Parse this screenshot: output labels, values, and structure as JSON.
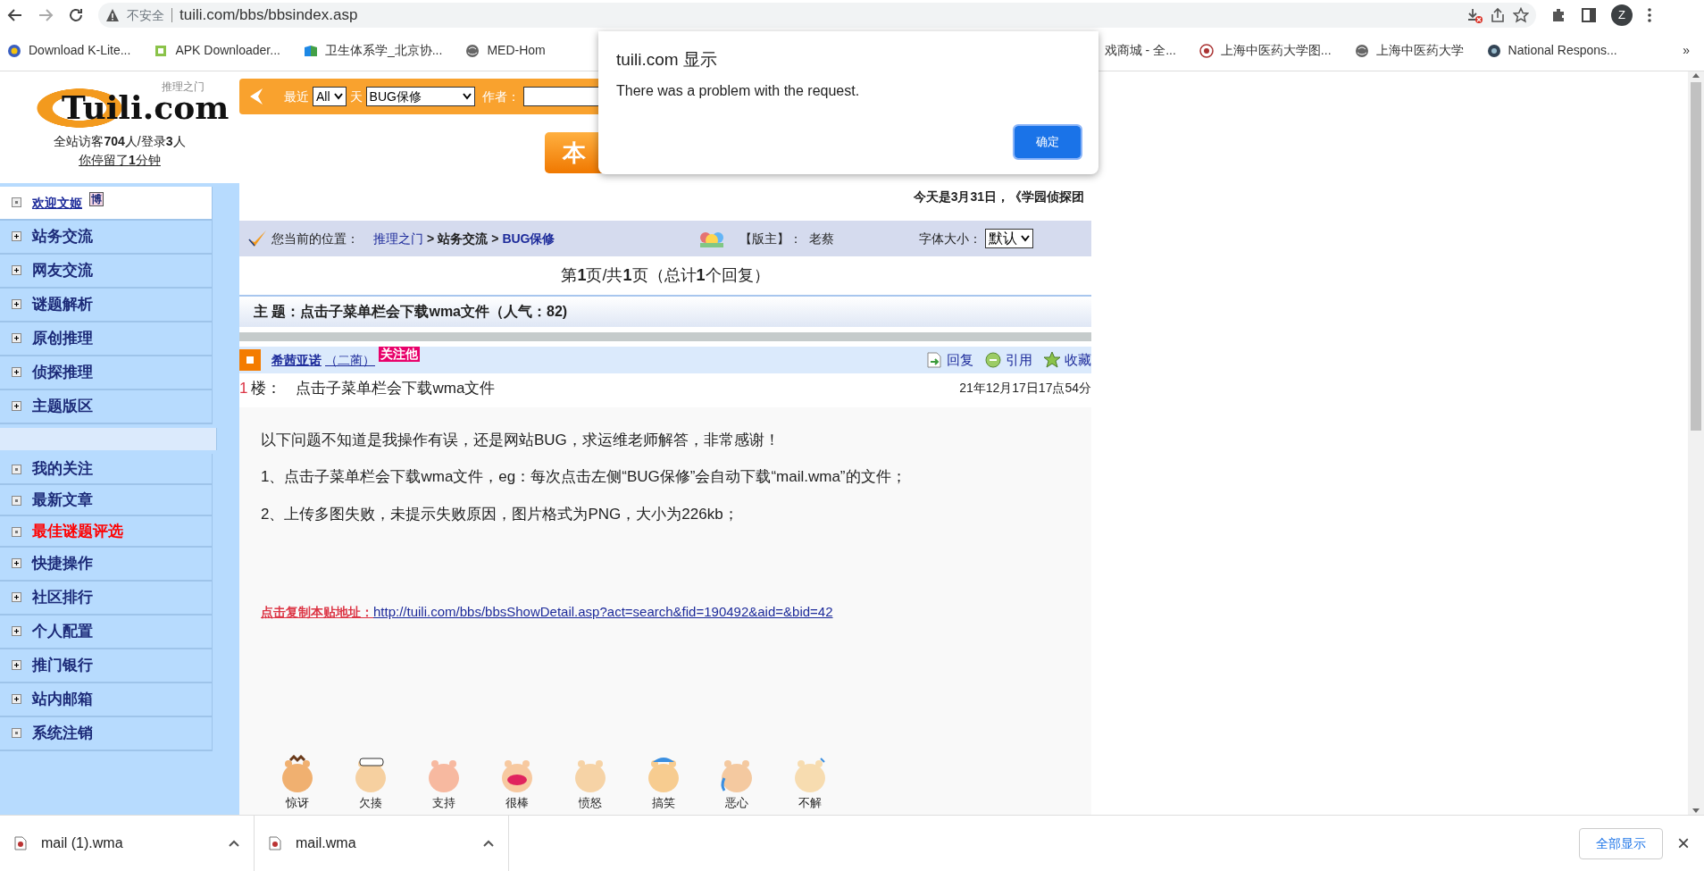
{
  "browser": {
    "security": "不安全",
    "url": "tuili.com/bbs/bbsindex.asp",
    "profile": "Z"
  },
  "bookmarks": [
    {
      "label": "Download K-Lite..."
    },
    {
      "label": "APK Downloader..."
    },
    {
      "label": "卫生体系学_北京协..."
    },
    {
      "label": "MED-Hom"
    },
    {
      "label": "戏商城 - 全..."
    },
    {
      "label": "上海中医药大学图..."
    },
    {
      "label": "上海中医药大学"
    },
    {
      "label": "National Respons..."
    }
  ],
  "bookmarks_more": "»",
  "dialog": {
    "title": "tuili.com 显示",
    "message": "There was a problem with the request.",
    "button": "确定"
  },
  "site": {
    "logo": "Tuili.com",
    "logo_sub": "推理之门",
    "visitors": "全站访客**704**人/登录**3**人",
    "stay": "你停留了**1**分钟"
  },
  "sidebar": {
    "items": [
      {
        "kind": "user",
        "label": "欢迎文姬",
        "badge": "博",
        "expandable": false,
        "highlight": false
      },
      {
        "kind": "item",
        "label": "站务交流",
        "expandable": true,
        "highlight": false
      },
      {
        "kind": "item",
        "label": "网友交流",
        "expandable": true,
        "highlight": false
      },
      {
        "kind": "item",
        "label": "谜题解析",
        "expandable": true,
        "highlight": false
      },
      {
        "kind": "item",
        "label": "原创推理",
        "expandable": true,
        "highlight": false
      },
      {
        "kind": "item",
        "label": "侦探推理",
        "expandable": true,
        "highlight": false
      },
      {
        "kind": "item",
        "label": "主题版区",
        "expandable": true,
        "highlight": false
      },
      {
        "kind": "spacer"
      },
      {
        "kind": "item",
        "label": "我的关注",
        "expandable": false,
        "highlight": false
      },
      {
        "kind": "item",
        "label": "最新文章",
        "expandable": false,
        "highlight": false
      },
      {
        "kind": "item",
        "label": "最佳谜题评选",
        "expandable": false,
        "highlight": true
      },
      {
        "kind": "item",
        "label": "快捷操作",
        "expandable": true,
        "highlight": false
      },
      {
        "kind": "item",
        "label": "社区排行",
        "expandable": true,
        "highlight": false
      },
      {
        "kind": "item",
        "label": "个人配置",
        "expandable": true,
        "highlight": false
      },
      {
        "kind": "item",
        "label": "推门银行",
        "expandable": true,
        "highlight": false
      },
      {
        "kind": "item",
        "label": "站内邮箱",
        "expandable": true,
        "highlight": false
      },
      {
        "kind": "item",
        "label": "系统注销",
        "expandable": false,
        "highlight": false
      }
    ]
  },
  "filter": {
    "recent_label": "最近",
    "days_value": "All",
    "days_label": "天",
    "board_value": "BUG保修",
    "author_label": "作者："
  },
  "banner": {
    "label": "本"
  },
  "today": "今天是**3月31日**，《学园侦探团",
  "breadcrumb": {
    "label": "您当前的位置：",
    "links": [
      "推理之门",
      "站务交流",
      "BUG保修"
    ],
    "separator": ">",
    "moderator_label": "【版主】：",
    "moderator": "老蔡",
    "font_label": "字体大小：",
    "font_value": "默认"
  },
  "paging": "第**1**页/共**1**页（总计**1**个回复）",
  "topic": "主 题：点击子菜单栏会下载wma文件（人气：82)",
  "post": {
    "author": "希茜亚诺",
    "rank": "（二蔺）",
    "follow": "关注他",
    "actions": [
      "回复",
      "引用",
      "收藏"
    ],
    "floor": "1",
    "floor_label": "楼：",
    "title": "点击子菜单栏会下载wma文件",
    "date": "21年12月17日17点54分",
    "body": [
      "以下问题不知道是我操作有误，还是网站BUG，求运维老师解答，非常感谢！",
      "1、点击子菜单栏会下载wma文件，eg：每次点击左侧“BUG保修”会自动下载“mail.wma”的文件；",
      "2、上传多图失败，未提示失败原因，图片格式为PNG，大小为226kb；"
    ],
    "copy_label": "点击复制本贴地址：",
    "copy_url": "http://tuili.com/bbs/bbsShowDetail.asp?act=search&fid=190492&aid=&bid=42"
  },
  "emoticons": [
    "惊讶",
    "欠揍",
    "支持",
    "很棒",
    "愤怒",
    "搞笑",
    "恶心",
    "不解"
  ],
  "downloads": {
    "files": [
      "mail (1).wma",
      "mail.wma"
    ],
    "show_all": "全部显示",
    "close": "×"
  }
}
